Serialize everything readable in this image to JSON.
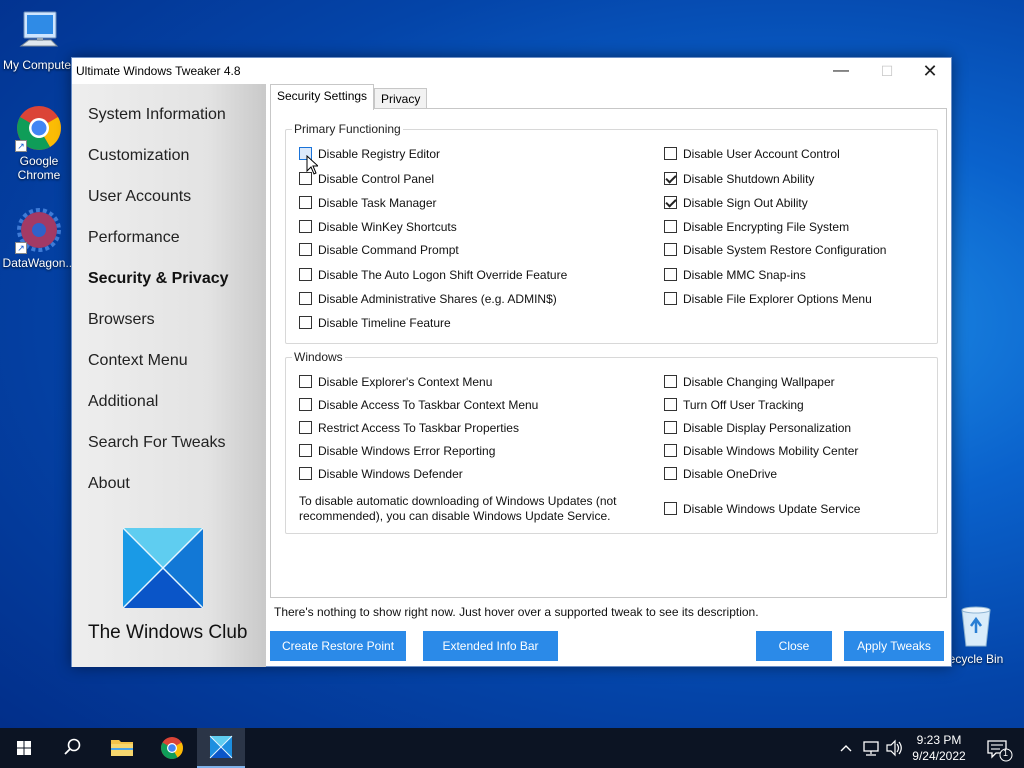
{
  "desktop": {
    "icons": [
      {
        "label": "My Computer"
      },
      {
        "label": "Google Chrome"
      },
      {
        "label": "DataWagon..."
      }
    ],
    "recycle_bin": {
      "label": "Recycle Bin"
    }
  },
  "window": {
    "title": "Ultimate Windows Tweaker 4.8",
    "controls": {
      "minimize": "—",
      "maximize": "☐",
      "close": "✕"
    }
  },
  "sidebar": {
    "items": [
      {
        "label": "System Information"
      },
      {
        "label": "Customization"
      },
      {
        "label": "User Accounts"
      },
      {
        "label": "Performance"
      },
      {
        "label": "Security & Privacy",
        "active": true
      },
      {
        "label": "Browsers"
      },
      {
        "label": "Context Menu"
      },
      {
        "label": "Additional"
      },
      {
        "label": "Search For Tweaks"
      },
      {
        "label": "About"
      }
    ],
    "brand": "The Windows Club"
  },
  "tabs": [
    {
      "label": "Security Settings",
      "active": true
    },
    {
      "label": "Privacy",
      "active": false
    }
  ],
  "groups": {
    "primary": {
      "title": "Primary Functioning",
      "left": [
        {
          "label": "Disable Registry Editor",
          "checked": false
        },
        {
          "label": "Disable Control Panel",
          "checked": false
        },
        {
          "label": "Disable Task Manager",
          "checked": false
        },
        {
          "label": "Disable WinKey Shortcuts",
          "checked": false
        },
        {
          "label": "Disable Command Prompt",
          "checked": false
        },
        {
          "label": "Disable The Auto Logon Shift Override Feature",
          "checked": false
        },
        {
          "label": "Disable Administrative Shares (e.g. ADMIN$)",
          "checked": false
        },
        {
          "label": "Disable Timeline Feature",
          "checked": false
        }
      ],
      "right": [
        {
          "label": "Disable User Account Control",
          "checked": false
        },
        {
          "label": "Disable Shutdown Ability",
          "checked": true
        },
        {
          "label": "Disable Sign Out Ability",
          "checked": true
        },
        {
          "label": "Disable Encrypting File System",
          "checked": false
        },
        {
          "label": "Disable System Restore Configuration",
          "checked": false
        },
        {
          "label": "Disable MMC Snap-ins",
          "checked": false
        },
        {
          "label": "Disable File Explorer Options Menu",
          "checked": false
        }
      ]
    },
    "windows": {
      "title": "Windows",
      "left": [
        {
          "label": "Disable Explorer's Context Menu",
          "checked": false
        },
        {
          "label": "Disable Access To Taskbar Context Menu",
          "checked": false
        },
        {
          "label": "Restrict Access To Taskbar Properties",
          "checked": false
        },
        {
          "label": "Disable Windows Error Reporting",
          "checked": false
        },
        {
          "label": "Disable Windows Defender",
          "checked": false
        }
      ],
      "right": [
        {
          "label": "Disable Changing Wallpaper",
          "checked": false
        },
        {
          "label": "Turn Off User Tracking",
          "checked": false
        },
        {
          "label": "Disable Display Personalization",
          "checked": false
        },
        {
          "label": "Disable Windows Mobility Center",
          "checked": false
        },
        {
          "label": "Disable OneDrive",
          "checked": false
        }
      ],
      "note_line1": "To disable automatic downloading of Windows Updates (not",
      "note_line2": "recommended), you can disable Windows Update Service.",
      "update_service": {
        "label": "Disable Windows Update Service",
        "checked": false
      }
    }
  },
  "status_text": "There's nothing to show right now. Just hover over a supported tweak to see its description.",
  "buttons": {
    "restore": "Create Restore Point",
    "info_bar": "Extended Info Bar",
    "close": "Close",
    "apply": "Apply Tweaks"
  },
  "taskbar": {
    "time": "9:23 PM",
    "date": "9/24/2022",
    "notification_count": "1"
  },
  "colors": {
    "accent_button": "#2b8ae8",
    "taskbar": "#0c1423",
    "desktop": "#0a62cc"
  }
}
